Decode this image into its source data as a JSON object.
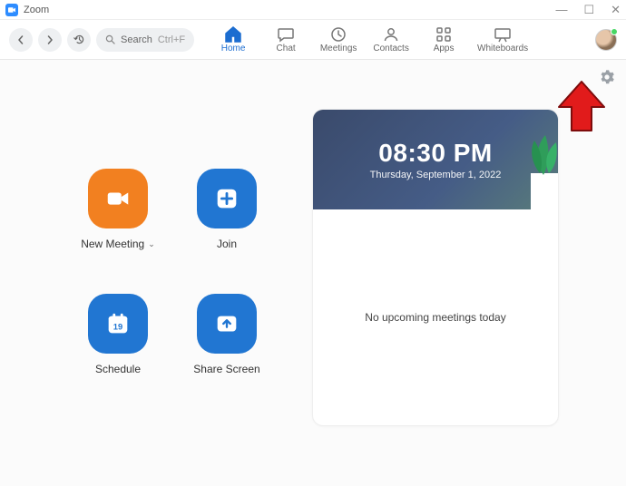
{
  "window": {
    "title": "Zoom"
  },
  "toolbar": {
    "search_label": "Search",
    "search_shortcut": "Ctrl+F",
    "tabs": [
      {
        "label": "Home"
      },
      {
        "label": "Chat"
      },
      {
        "label": "Meetings"
      },
      {
        "label": "Contacts"
      },
      {
        "label": "Apps"
      },
      {
        "label": "Whiteboards"
      }
    ],
    "active_tab_index": 0
  },
  "actions": {
    "new_meeting": "New Meeting",
    "join": "Join",
    "schedule": "Schedule",
    "share_screen": "Share Screen",
    "schedule_day": "19"
  },
  "info_card": {
    "time": "08:30 PM",
    "date": "Thursday, September 1, 2022",
    "no_meetings": "No upcoming meetings today"
  },
  "annotation": {
    "target": "settings-gear",
    "color": "#e11b1b"
  }
}
